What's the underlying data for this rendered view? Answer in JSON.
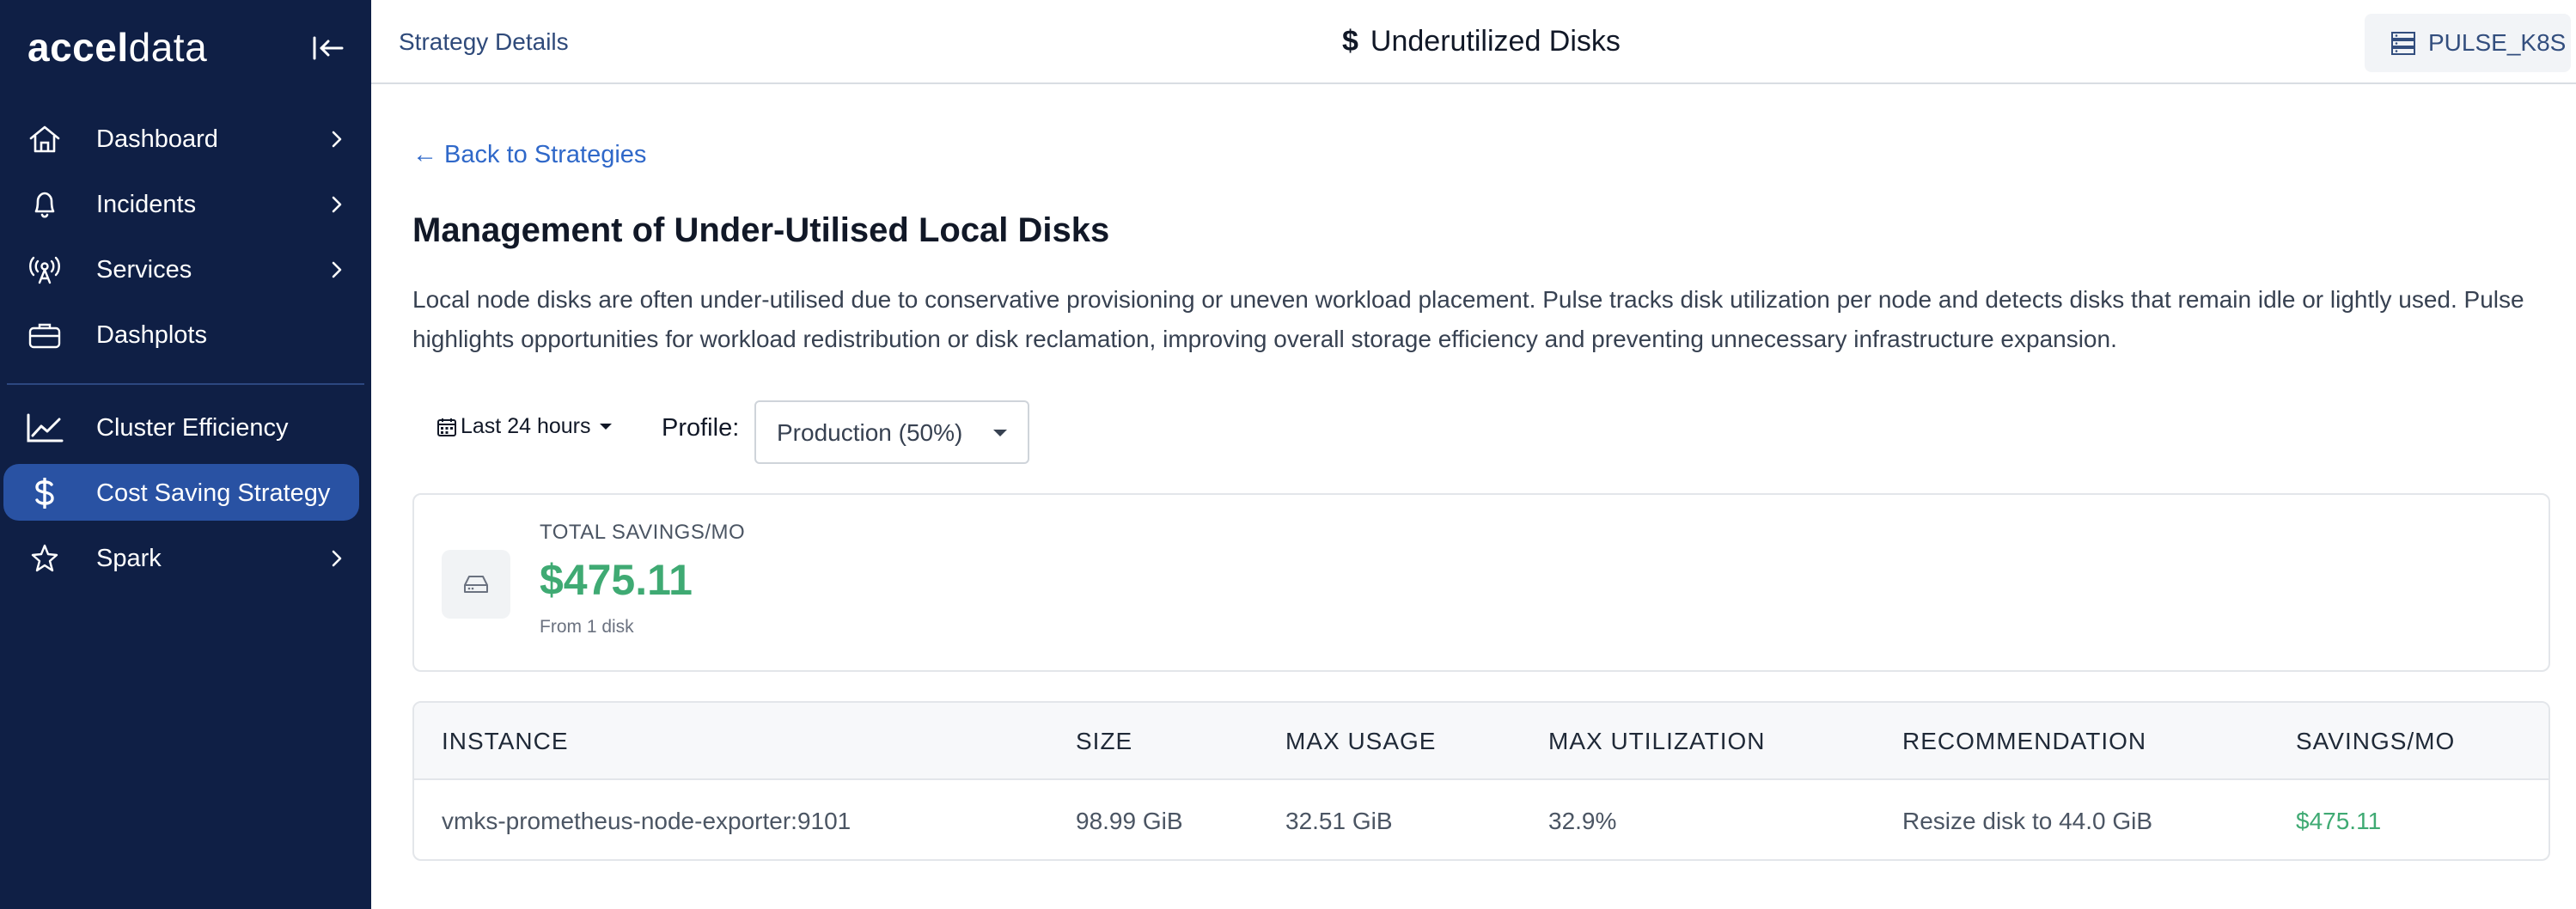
{
  "sidebar": {
    "logo_bold": "accel",
    "logo_light": "data",
    "items": [
      {
        "label": "Dashboard",
        "icon": "home-icon",
        "has_submenu": true
      },
      {
        "label": "Incidents",
        "icon": "bell-icon",
        "has_submenu": true
      },
      {
        "label": "Services",
        "icon": "antenna-icon",
        "has_submenu": true
      },
      {
        "label": "Dashplots",
        "icon": "briefcase-icon",
        "has_submenu": false
      },
      {
        "label": "Cluster Efficiency",
        "icon": "trend-chart-icon",
        "has_submenu": false
      },
      {
        "label": "Cost Saving Strategy",
        "icon": "dollar-icon",
        "has_submenu": false,
        "active": true
      },
      {
        "label": "Spark",
        "icon": "spark-icon",
        "has_submenu": true
      }
    ]
  },
  "header": {
    "breadcrumb": "Strategy Details",
    "title": "Underutilized Disks",
    "title_icon": "$",
    "cluster": "PULSE_K8S"
  },
  "main": {
    "back_link": "← Back to Strategies",
    "title": "Management of Under-Utilised Local Disks",
    "description": "Local node disks are often under-utilised due to conservative provisioning or uneven workload placement. Pulse tracks disk utilization per node and detects disks that remain idle or lightly used. Pulse highlights opportunities for workload redistribution or disk reclamation, improving overall storage efficiency and preventing unnecessary infrastructure expansion.",
    "time_range": "Last 24 hours",
    "profile_label": "Profile:",
    "profile_value": "Production (50%)",
    "summary": {
      "label": "TOTAL SAVINGS/MO",
      "value": "$475.11",
      "sub": "From 1 disk"
    },
    "table": {
      "headers": [
        "INSTANCE",
        "SIZE",
        "MAX USAGE",
        "MAX UTILIZATION",
        "RECOMMENDATION",
        "SAVINGS/MO"
      ],
      "rows": [
        [
          "vmks-prometheus-node-exporter:9101",
          "98.99 GiB",
          "32.51 GiB",
          "32.9%",
          "Resize disk to 44.0 GiB",
          "$475.11"
        ]
      ]
    }
  },
  "colors": {
    "sidebar_bg": "#0f1f45",
    "active_bg": "#2952a3",
    "link": "#2f68c9",
    "savings_green": "#3faa73"
  }
}
